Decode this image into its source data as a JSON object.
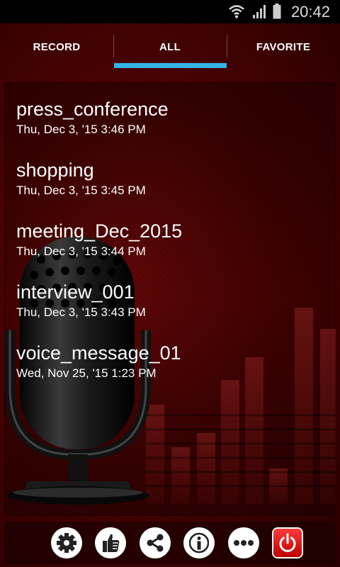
{
  "status_bar": {
    "time": "20:42",
    "icons": [
      "wifi-icon",
      "signal-icon",
      "battery-icon"
    ]
  },
  "tabs": [
    {
      "label": "RECORD",
      "selected": false
    },
    {
      "label": "ALL",
      "selected": true
    },
    {
      "label": "FAVORITE",
      "selected": false
    }
  ],
  "recordings": [
    {
      "name": "press_conference",
      "date": "Thu, Dec 3, '15 3:46 PM"
    },
    {
      "name": "shopping",
      "date": "Thu, Dec 3, '15 3:45 PM"
    },
    {
      "name": "meeting_Dec_2015",
      "date": "Thu, Dec 3, '15 3:44 PM"
    },
    {
      "name": "interview_001",
      "date": "Thu, Dec 3, '15 3:43 PM"
    },
    {
      "name": "voice_message_01",
      "date": "Wed, Nov 25, '15 1:23 PM"
    }
  ],
  "bottom_bar": {
    "buttons": [
      "settings-icon",
      "thumbs-up-icon",
      "share-icon",
      "info-icon",
      "more-icon",
      "power-icon"
    ]
  },
  "colors": {
    "accent": "#33b5e5",
    "background": "#4b0202",
    "power": "#e00000"
  }
}
